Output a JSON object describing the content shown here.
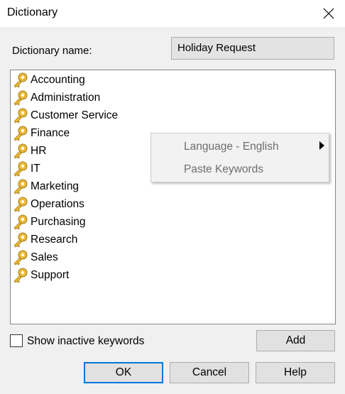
{
  "window": {
    "title": "Dictionary"
  },
  "form": {
    "dictionary_name_label": "Dictionary name:",
    "dictionary_name_value": "Holiday Request"
  },
  "keywords": [
    "Accounting",
    "Administration",
    "Customer Service",
    "Finance",
    "HR",
    "IT",
    "Marketing",
    "Operations",
    "Purchasing",
    "Research",
    "Sales",
    "Support"
  ],
  "context_menu": {
    "items": [
      {
        "label": "Language - English",
        "has_submenu": true
      },
      {
        "label": "Paste Keywords",
        "has_submenu": false
      }
    ]
  },
  "options": {
    "show_inactive_label": "Show inactive keywords",
    "show_inactive_checked": false
  },
  "buttons": {
    "add": "Add",
    "ok": "OK",
    "cancel": "Cancel",
    "help": "Help"
  },
  "icons": {
    "keyword": "key-icon",
    "close": "close-icon",
    "submenu": "chevron-right-icon"
  },
  "colors": {
    "accent": "#0078d7",
    "key_gold": "#e8b93a"
  }
}
